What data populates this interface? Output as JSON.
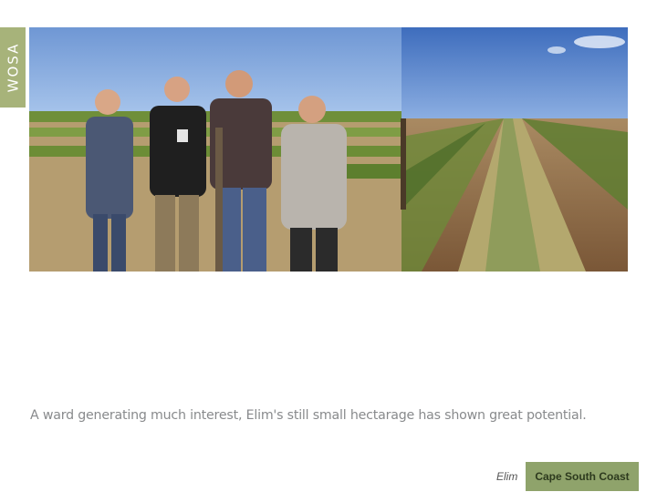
{
  "brand": {
    "label": "WOSA",
    "color": "#a7b37a"
  },
  "photo": {
    "description_icon": "photo-vineyard-winemakers"
  },
  "caption": "A ward generating much interest, Elim's still small hectarage has shown great potential.",
  "footer": {
    "ward": "Elim",
    "region": "Cape South Coast",
    "region_color": "#8fa36b"
  }
}
